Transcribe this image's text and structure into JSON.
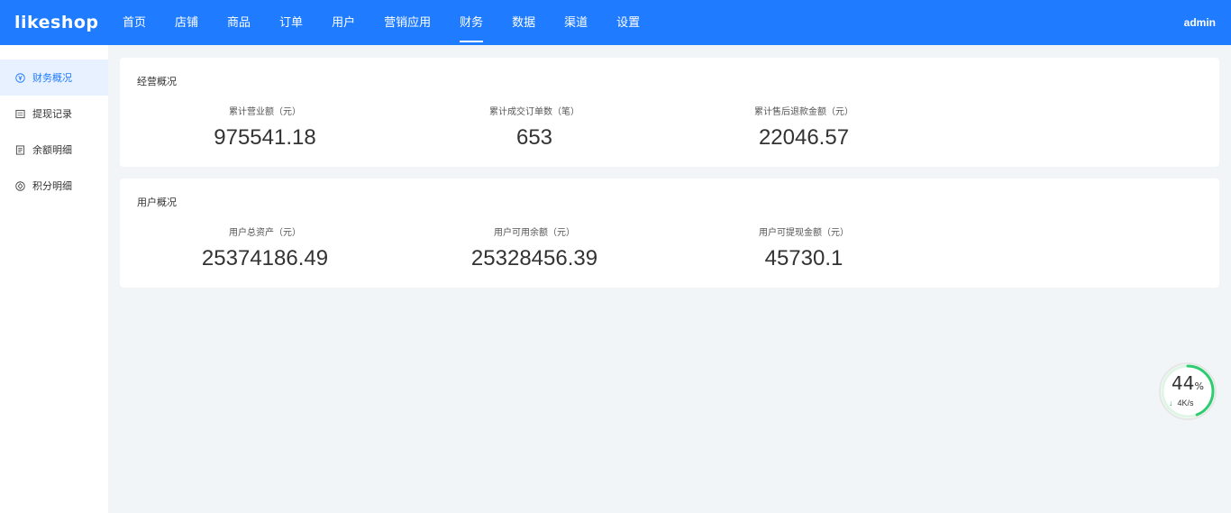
{
  "app": {
    "logo": "likeshop",
    "user": "admin"
  },
  "nav": [
    "首页",
    "店铺",
    "商品",
    "订单",
    "用户",
    "营销应用",
    "财务",
    "数据",
    "渠道",
    "设置"
  ],
  "sidebar": [
    "财务概况",
    "提现记录",
    "余额明细",
    "积分明细"
  ],
  "business": {
    "title": "经营概况",
    "stats": [
      {
        "label": "累计营业额（元）",
        "value": "975541.18"
      },
      {
        "label": "累计成交订单数（笔）",
        "value": "653"
      },
      {
        "label": "累计售后退款金额（元）",
        "value": "22046.57"
      }
    ]
  },
  "users": {
    "title": "用户概况",
    "stats": [
      {
        "label": "用户总资产（元）",
        "value": "25374186.49"
      },
      {
        "label": "用户可用余额（元）",
        "value": "25328456.39"
      },
      {
        "label": "用户可提现金额（元）",
        "value": "45730.1"
      }
    ]
  },
  "speed_widget": {
    "percent": "44",
    "percent_unit": "%",
    "rate": "4K/s",
    "level": 0.44
  },
  "colors": {
    "brand": "#1f7bff",
    "sidebar_active_bg": "#e8f1ff",
    "widget_ring": "#2ecc71"
  }
}
